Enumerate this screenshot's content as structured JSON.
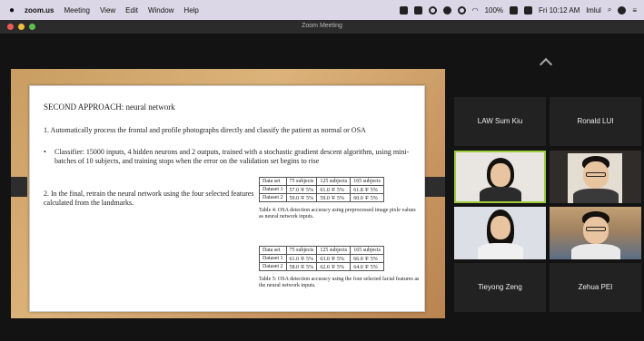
{
  "menubar": {
    "app_name": "zoom.us",
    "items": [
      "Meeting",
      "View",
      "Edit",
      "Window",
      "Help"
    ],
    "battery": "100%",
    "clock": "Fri 10:12 AM",
    "user": "lmlul"
  },
  "window": {
    "title": "Zoom Meeting"
  },
  "slide": {
    "title": "SECOND APPROACH: neural network",
    "point1": "1. Automatically process the frontal and profile photographs directly and classify the patient as normal or OSA",
    "bullet_mark": "•",
    "bullet_text": "Classifier: 15000 inputs, 4 hidden neurons and 2 outputs, trained with a stochastic gradient descent algorithm, using mini-batches of 10 subjects, and training stops when the error on the validation set begins to rise",
    "point2": "2. In the final, retrain the neural network using the four selected features calculated from the landmarks.",
    "table1": {
      "headers": [
        "Data set",
        "75 subjects",
        "125 subjects",
        "165 subjects"
      ],
      "rows": [
        [
          "Dataset 1",
          "57.0 ∓ 5%",
          "61.0 ∓ 5%",
          "61.8 ∓ 5%"
        ],
        [
          "Dataset 2",
          "59.0 ∓ 5%",
          "59.0 ∓ 5%",
          "60.0 ∓ 5%"
        ]
      ],
      "caption": "Table 4: OSA detection accuracy using preprocessed image pixle values as neural network inputs."
    },
    "table2": {
      "headers": [
        "Data set",
        "75 subjects",
        "125 subjects",
        "165 subjects"
      ],
      "rows": [
        [
          "Dataset 1",
          "61.0 ∓ 5%",
          "63.0 ∓ 5%",
          "66.0 ∓ 5%"
        ],
        [
          "Dataset 2",
          "58.0 ∓ 5%",
          "62.0 ∓ 5%",
          "64.0 ∓ 5%"
        ]
      ],
      "caption": "Table 5: OSA detection accuracy using the four selected facial features as the neural network inputs."
    }
  },
  "participants": {
    "law": "LAW Sum Kiu",
    "ronald": "Ronald LUI",
    "tieyong": "Tieyong Zeng",
    "zehua": "Zehua PEI"
  }
}
